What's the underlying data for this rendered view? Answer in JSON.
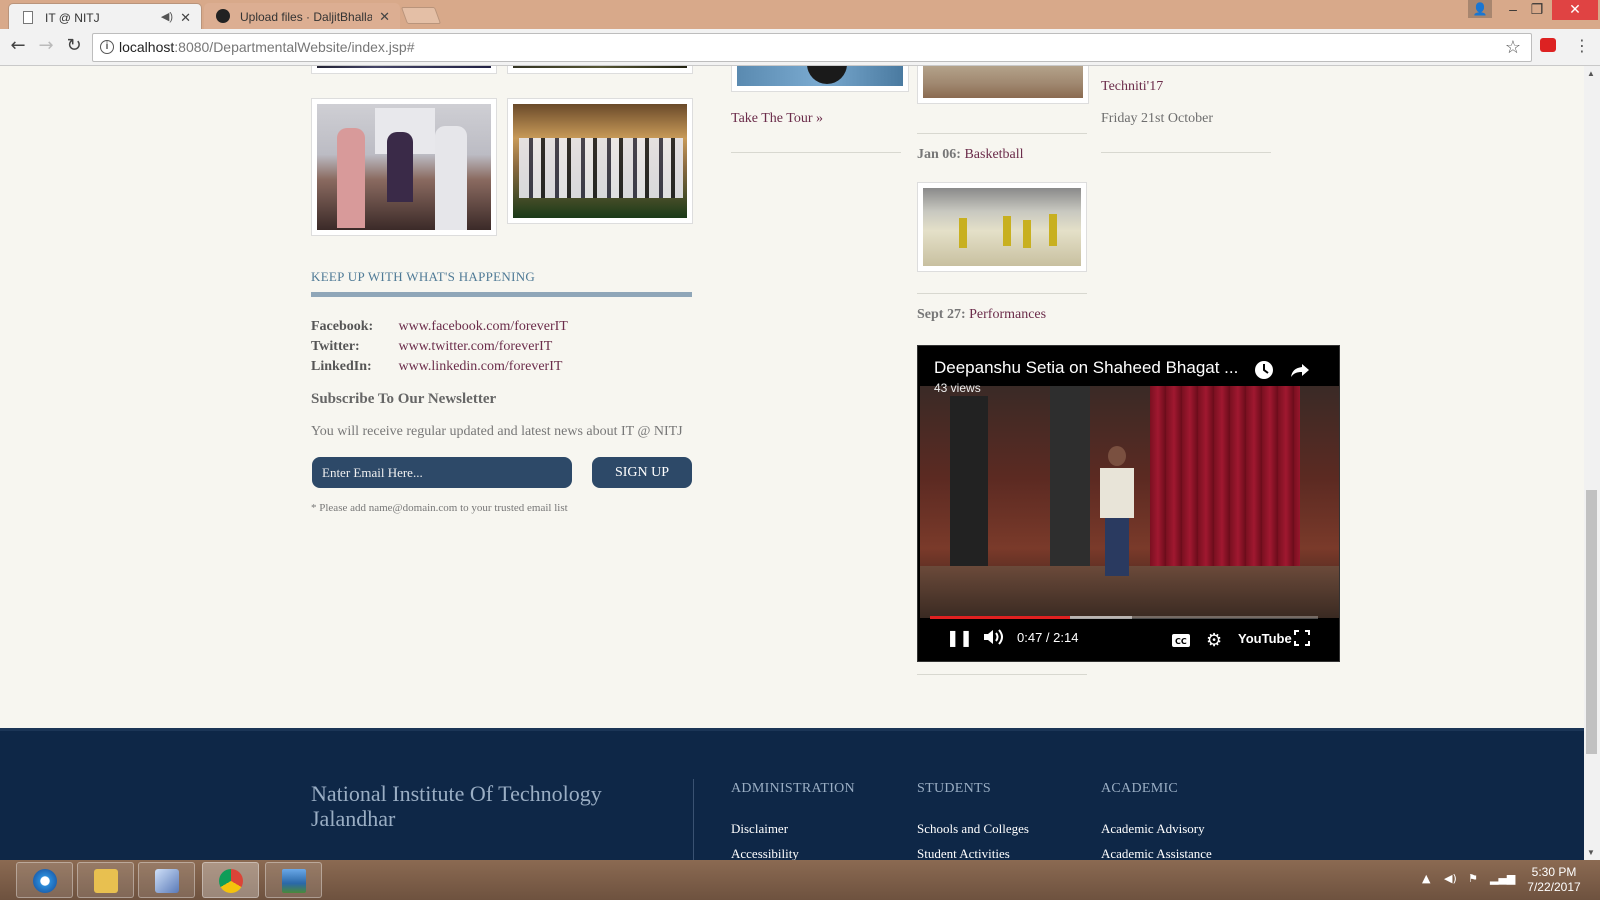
{
  "browser": {
    "tabs": [
      {
        "title": "IT @ NITJ"
      },
      {
        "title": "Upload files · DaljitBhalla"
      }
    ],
    "url_host": "localhost",
    "url_path": ":8080/DepartmentalWebsite/index.jsp#"
  },
  "gallery": {},
  "happening": {
    "title": "KEEP UP WITH WHAT'S HAPPENING",
    "social": [
      {
        "label": "Facebook:",
        "value": "www.facebook.com/foreverIT"
      },
      {
        "label": "Twitter:",
        "value": "www.twitter.com/foreverIT"
      },
      {
        "label": "LinkedIn:",
        "value": "www.linkedin.com/foreverIT"
      }
    ],
    "newsletter_heading": "Subscribe To Our Newsletter",
    "newsletter_text": "You will receive regular updated and latest news about IT @ NITJ",
    "email_placeholder": "Enter Email Here...",
    "signup_label": "SIGN UP",
    "note": "* Please add name@domain.com to your trusted email list"
  },
  "tour": {
    "label": "Take The Tour »"
  },
  "events": {
    "basketball": {
      "date": "Jan 06:",
      "title": "Basketball"
    },
    "performances": {
      "date": "Sept 27:",
      "title": "Performances"
    }
  },
  "upcoming": {
    "title": "Techniti'17",
    "date": "Friday 21st October"
  },
  "video": {
    "title": "Deepanshu Setia on Shaheed Bhagat ...",
    "views": "43 views",
    "time": "0:47 / 2:14",
    "progress_fraction": 0.36,
    "brand": "YouTube"
  },
  "footer": {
    "institute": "National Institute Of Technology Jalandhar",
    "columns": [
      {
        "heading": "ADMINISTRATION",
        "links": [
          "Disclaimer",
          "Accessibility"
        ]
      },
      {
        "heading": "STUDENTS",
        "links": [
          "Schools and Colleges",
          "Student Activities"
        ]
      },
      {
        "heading": "ACADEMIC",
        "links": [
          "Academic Advisory",
          "Academic Assistance"
        ]
      }
    ]
  },
  "taskbar": {
    "time": "5:30 PM",
    "date": "7/22/2017"
  },
  "colors": {
    "footer_bg": "#0e2747",
    "button_bg": "#2d4968",
    "link": "#6b2c4a",
    "tabbar": "#d8a98a"
  }
}
